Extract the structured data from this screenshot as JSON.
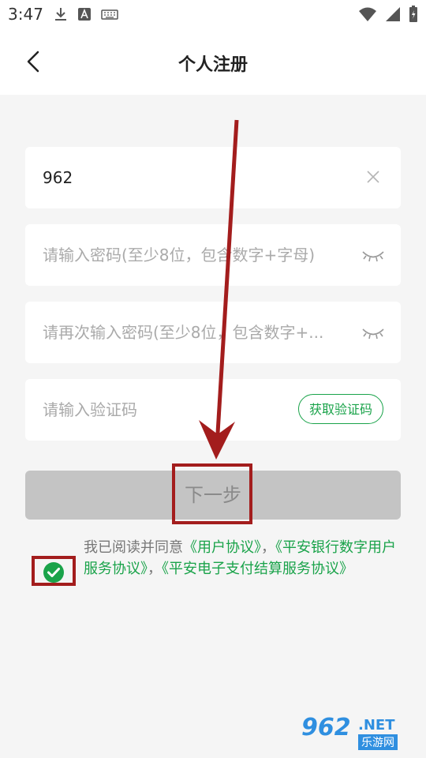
{
  "status_bar": {
    "time": "3:47",
    "icons_left": [
      "download-icon",
      "a-app-icon",
      "keyboard-icon"
    ],
    "icons_right": [
      "wifi-icon",
      "signal-icon",
      "battery-icon"
    ]
  },
  "header": {
    "title": "个人注册",
    "back_icon": "chevron-left-icon"
  },
  "form": {
    "phone": {
      "value": "962",
      "clear_icon": "close-icon"
    },
    "password": {
      "placeholder": "请输入密码(至少8位，包含数字+字母)",
      "toggle_icon": "eye-closed-icon"
    },
    "password_confirm": {
      "placeholder": "请再次输入密码(至少8位，包含数字+...",
      "toggle_icon": "eye-closed-icon"
    },
    "verify_code": {
      "placeholder": "请输入验证码",
      "get_code_label": "获取验证码"
    }
  },
  "next_button": {
    "label": "下一步"
  },
  "agreement": {
    "prefix": "我已阅读并同意",
    "link1": "《用户协议》",
    "sep1": "，",
    "link2": "《平安银行数字用户服务协议》",
    "sep2": "，",
    "link3": "《平安电子支付结算服务协议》",
    "checked": true
  },
  "watermark": {
    "number": "962",
    "domain": ".NET",
    "sub": "乐游网"
  },
  "colors": {
    "accent": "#1aa34a",
    "annotation": "#a31d1d",
    "button_disabled": "#c4c4c4",
    "placeholder": "#aaaaaa"
  }
}
